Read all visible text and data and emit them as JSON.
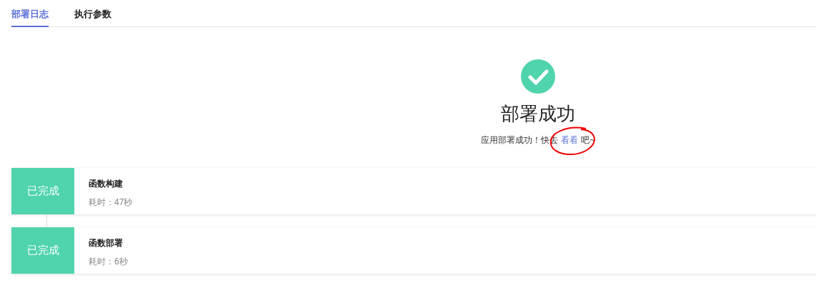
{
  "tabs": [
    {
      "label": "部署日志",
      "selected": true
    },
    {
      "label": "执行参数",
      "selected": false
    }
  ],
  "result": {
    "title": "部署成功",
    "message_before": "应用部署成功！快去",
    "link": "看看",
    "message_after": "吧~"
  },
  "steps": [
    {
      "status": "已完成",
      "name": "函数构建",
      "duration": "耗时：47秒"
    },
    {
      "status": "已完成",
      "name": "函数部署",
      "duration": "耗时：6秒"
    }
  ]
}
